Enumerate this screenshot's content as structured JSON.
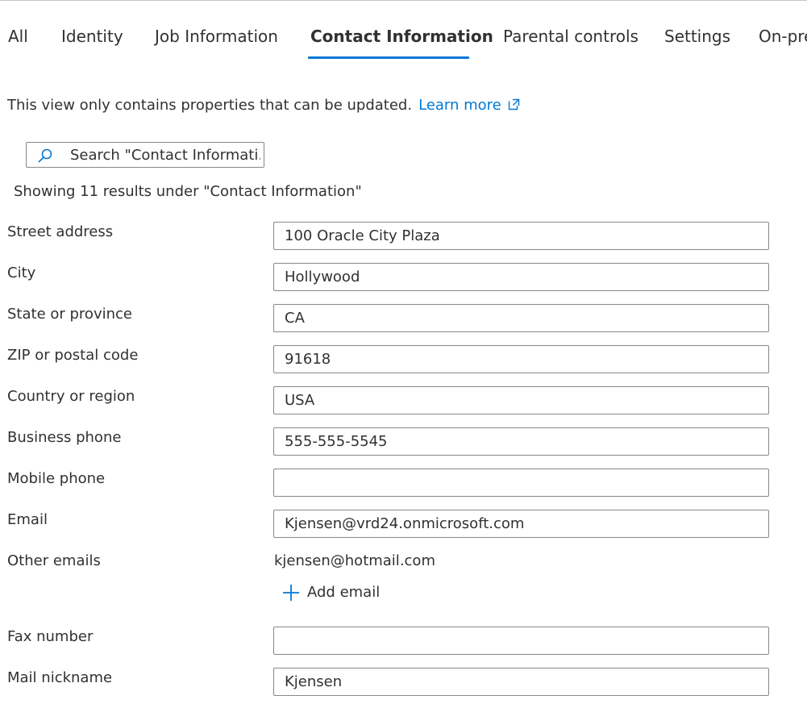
{
  "tabs": [
    {
      "label": "All"
    },
    {
      "label": "Identity"
    },
    {
      "label": "Job Information"
    },
    {
      "label": "Contact Information"
    },
    {
      "label": "Parental controls"
    },
    {
      "label": "Settings"
    },
    {
      "label": "On-pre"
    }
  ],
  "notice": {
    "text": "This view only contains properties that can be updated.",
    "link": "Learn more",
    "link_icon": "open-in-new-window-icon"
  },
  "search": {
    "placeholder": "Search \"Contact Informati...",
    "icon": "search-icon"
  },
  "results_text": "Showing 11 results under \"Contact Information\"",
  "fields": {
    "street_address": {
      "label": "Street address",
      "value": "100 Oracle City Plaza"
    },
    "city": {
      "label": "City",
      "value": "Hollywood"
    },
    "state": {
      "label": "State or province",
      "value": "CA"
    },
    "zip": {
      "label": "ZIP or postal code",
      "value": "91618"
    },
    "country": {
      "label": "Country or region",
      "value": "USA"
    },
    "business_phone": {
      "label": "Business phone",
      "value": "555-555-5545"
    },
    "mobile_phone": {
      "label": "Mobile phone",
      "value": ""
    },
    "email": {
      "label": "Email",
      "value": "Kjensen@vrd24.onmicrosoft.com"
    },
    "other_emails": {
      "label": "Other emails",
      "value": "kjensen@hotmail.com",
      "add_label": "Add email",
      "add_icon": "plus-icon"
    },
    "fax": {
      "label": "Fax number",
      "value": ""
    },
    "mail_nickname": {
      "label": "Mail nickname",
      "value": "Kjensen"
    }
  },
  "colors": {
    "accent": "#0078d4",
    "text": "#323130",
    "border": "#8a8886"
  }
}
